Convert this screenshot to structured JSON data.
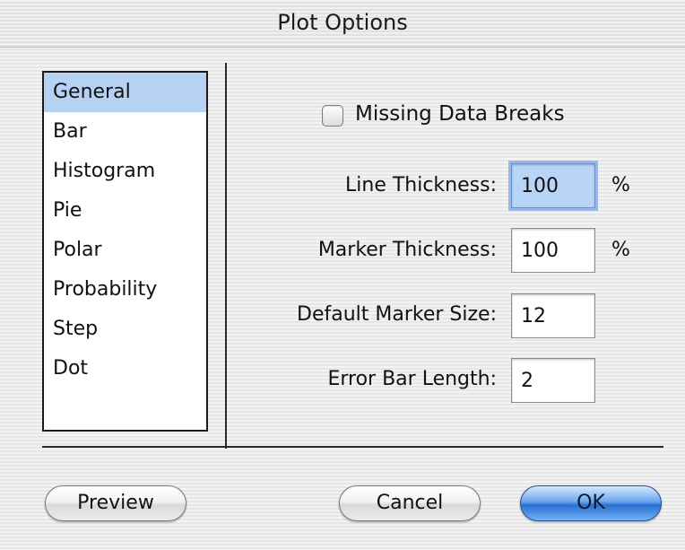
{
  "window": {
    "title": "Plot Options"
  },
  "sidebar": {
    "items": [
      {
        "label": "General",
        "selected": true
      },
      {
        "label": "Bar"
      },
      {
        "label": "Histogram"
      },
      {
        "label": "Pie"
      },
      {
        "label": "Polar"
      },
      {
        "label": "Probability"
      },
      {
        "label": "Step"
      },
      {
        "label": "Dot"
      }
    ]
  },
  "options": {
    "missing_data_breaks": {
      "label": "Missing Data Breaks",
      "checked": false
    },
    "line_thickness": {
      "label": "Line Thickness:",
      "value": "100",
      "unit": "%"
    },
    "marker_thickness": {
      "label": "Marker Thickness:",
      "value": "100",
      "unit": "%"
    },
    "default_marker_size": {
      "label": "Default Marker Size:",
      "value": "12"
    },
    "error_bar_length": {
      "label": "Error Bar Length:",
      "value": "2"
    }
  },
  "buttons": {
    "preview": "Preview",
    "cancel": "Cancel",
    "ok": "OK"
  },
  "colors": {
    "selection": "#b5d2f5",
    "default_button": "#2c6fd1"
  }
}
